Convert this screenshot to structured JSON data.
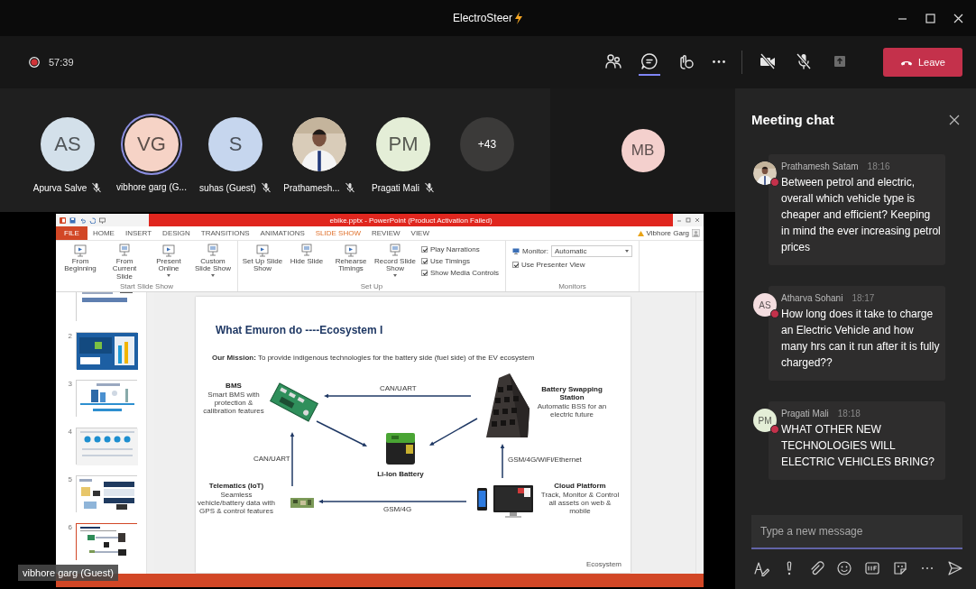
{
  "window": {
    "title": "ElectroSteer"
  },
  "meeting": {
    "recording": true,
    "duration": "57:39"
  },
  "toolbar": {
    "items": [
      {
        "kind": "participants",
        "selected": false
      },
      {
        "kind": "chat",
        "selected": true
      },
      {
        "kind": "reactions",
        "selected": false
      },
      {
        "kind": "more",
        "selected": false
      },
      {
        "kind": "camera",
        "on": false
      },
      {
        "kind": "mic",
        "on": false
      },
      {
        "kind": "share",
        "selected": false
      }
    ],
    "leave": "Leave"
  },
  "participants": [
    {
      "kind": "initials",
      "initials": "AS",
      "name": "Apurva Salve",
      "color": "#d3e0ea",
      "muted": true,
      "speaking": false
    },
    {
      "kind": "initials",
      "initials": "VG",
      "name": "vibhore garg (G...",
      "color": "#f6d3c6",
      "muted": false,
      "speaking": true
    },
    {
      "kind": "initials",
      "initials": "S",
      "name": "suhas (Guest)",
      "color": "#c6d6ee",
      "muted": true,
      "speaking": false
    },
    {
      "name": "Prathamesh...",
      "muted": true,
      "speaking": false
    },
    {
      "kind": "initials",
      "initials": "PM",
      "name": "Pragati Mali",
      "color": "#e4eed7",
      "muted": true,
      "speaking": false
    },
    {
      "kind": "overflow",
      "count": "+43"
    }
  ],
  "pinned": {
    "initials": "MB",
    "color": "#f4d0cd"
  },
  "shared_screen": {
    "presenter": "vibhore garg (Guest)",
    "app": {
      "title": "ebike.pptx - PowerPoint (Product Activation Failed)",
      "user": "Vibhore Garg",
      "tabs": [
        {
          "label": "FILE",
          "kind": "file",
          "selected": false
        },
        {
          "label": "HOME",
          "kind": "tab",
          "selected": false
        },
        {
          "label": "INSERT",
          "kind": "tab",
          "selected": false
        },
        {
          "label": "DESIGN",
          "kind": "tab",
          "selected": false
        },
        {
          "label": "TRANSITIONS",
          "kind": "tab",
          "selected": false
        },
        {
          "label": "ANIMATIONS",
          "kind": "tab",
          "selected": false
        },
        {
          "label": "SLIDE SHOW",
          "kind": "tab",
          "selected": true
        },
        {
          "label": "REVIEW",
          "kind": "tab",
          "selected": false
        },
        {
          "label": "VIEW",
          "kind": "tab",
          "selected": false
        }
      ],
      "ribbon": [
        {
          "label": "Start Slide Show",
          "buttons": [
            {
              "label": "From Beginning",
              "dropdown": false
            },
            {
              "label": "From Current Slide",
              "dropdown": false
            },
            {
              "label": "Present Online",
              "dropdown": true
            },
            {
              "label": "Custom Slide Show",
              "dropdown": true
            }
          ]
        },
        {
          "label": "Set Up",
          "buttons": [
            {
              "label": "Set Up Slide Show",
              "dropdown": false
            },
            {
              "label": "Hide Slide",
              "dropdown": false
            },
            {
              "label": "Rehearse Timings",
              "dropdown": false
            },
            {
              "label": "Record Slide Show",
              "dropdown": true
            }
          ],
          "options": [
            {
              "kind": "checkbox",
              "label": "Play Narrations",
              "checked": true
            },
            {
              "kind": "checkbox",
              "label": "Use Timings",
              "checked": true
            },
            {
              "kind": "checkbox",
              "label": "Show Media Controls",
              "checked": true
            }
          ]
        },
        {
          "label": "Monitors",
          "options": [
            {
              "kind": "dropdown",
              "label": "Monitor:",
              "value": "Automatic"
            },
            {
              "kind": "checkbox",
              "label": "Use Presenter View",
              "checked": true
            }
          ]
        }
      ],
      "thumbnails": [
        {
          "selected": false
        },
        {
          "number": "2",
          "selected": false
        },
        {
          "number": "3",
          "selected": false
        },
        {
          "number": "4",
          "selected": false
        },
        {
          "number": "5",
          "selected": false
        },
        {
          "number": "6",
          "selected": true
        }
      ],
      "slide": {
        "title": "What Emuron do ----Ecosystem I",
        "mission": "**Our Mission:** To provide indigenous technologies for the battery side (fuel side) of the EV ecosystem",
        "nodes": [
          {
            "kind": "bms",
            "name": "BMS",
            "description": "Smart BMS with protection & calibration features"
          },
          {
            "kind": "station",
            "name": "Battery Swapping Station",
            "description": "Automatic BSS for an electric future"
          },
          {
            "kind": "battery",
            "name": "Li-Ion Battery"
          },
          {
            "kind": "telematics",
            "name": "Telematics (IoT)",
            "description": "Seamless vehicle/battery data with GPS & control features"
          },
          {
            "kind": "cloud",
            "name": "Cloud Platform",
            "description": "Track, Monitor & Control all assets on web & mobile"
          }
        ],
        "links": [
          {
            "kind": "top",
            "label": "CAN/UART"
          },
          {
            "kind": "left",
            "label": "CAN/UART"
          },
          {
            "kind": "right",
            "label": "GSM/4G/WiFi/Ethernet"
          },
          {
            "kind": "bottom",
            "label": "GSM/4G"
          },
          {
            "kind": "bms_battery"
          },
          {
            "kind": "station_battery"
          }
        ],
        "footer": "Ecosystem"
      }
    }
  },
  "chat": {
    "title": "Meeting chat",
    "messages": [
      {
        "author": "Prathamesh Satam",
        "time": "18:16",
        "presence": {
          "color": "#c4314b"
        },
        "text": "Between petrol and electric, overall which vehicle type is cheaper and efficient? Keeping in mind the ever increasing petrol prices"
      },
      {
        "author": "Atharva Sohani",
        "time": "18:17",
        "avatar": {
          "kind": "initials",
          "initials": "AS",
          "color": "#f4dde0"
        },
        "presence": {
          "color": "#c4314b"
        },
        "text": "How long does it take to charge an Electric Vehicle and how many hrs can it run after it is fully charged??"
      },
      {
        "author": "Pragati Mali",
        "time": "18:18",
        "avatar": {
          "kind": "initials",
          "initials": "PM",
          "color": "#e4eed7"
        },
        "presence": {
          "color": "#c4314b"
        },
        "text": "WHAT OTHER NEW TECHNOLOGIES WILL ELECTRIC VEHICLES BRING?"
      }
    ],
    "compose": {
      "placeholder": "Type a new message"
    }
  }
}
